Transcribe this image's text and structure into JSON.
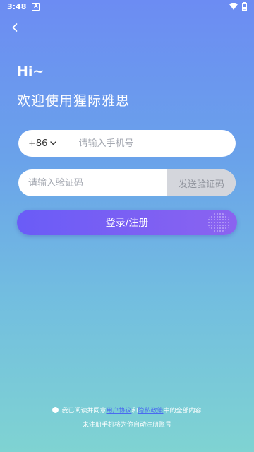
{
  "status_bar": {
    "time": "3:48",
    "notif_icon": "A"
  },
  "header": {
    "greeting": "Hi~",
    "welcome": "欢迎使用猩际雅思"
  },
  "phone": {
    "country_code": "+86",
    "placeholder": "请输入手机号",
    "value": ""
  },
  "code": {
    "placeholder": "请输入验证码",
    "value": "",
    "send_label": "发送验证码"
  },
  "login": {
    "label": "登录/注册"
  },
  "agreement": {
    "prefix": "我已阅读并同意",
    "user_agreement": "用户协议",
    "and": "和",
    "privacy_policy": "隐私政策",
    "suffix": "中的全部内容",
    "note": "未注册手机将为你自动注册账号"
  },
  "colors": {
    "accent": "#6a5cf7",
    "link": "#4a6af0"
  }
}
